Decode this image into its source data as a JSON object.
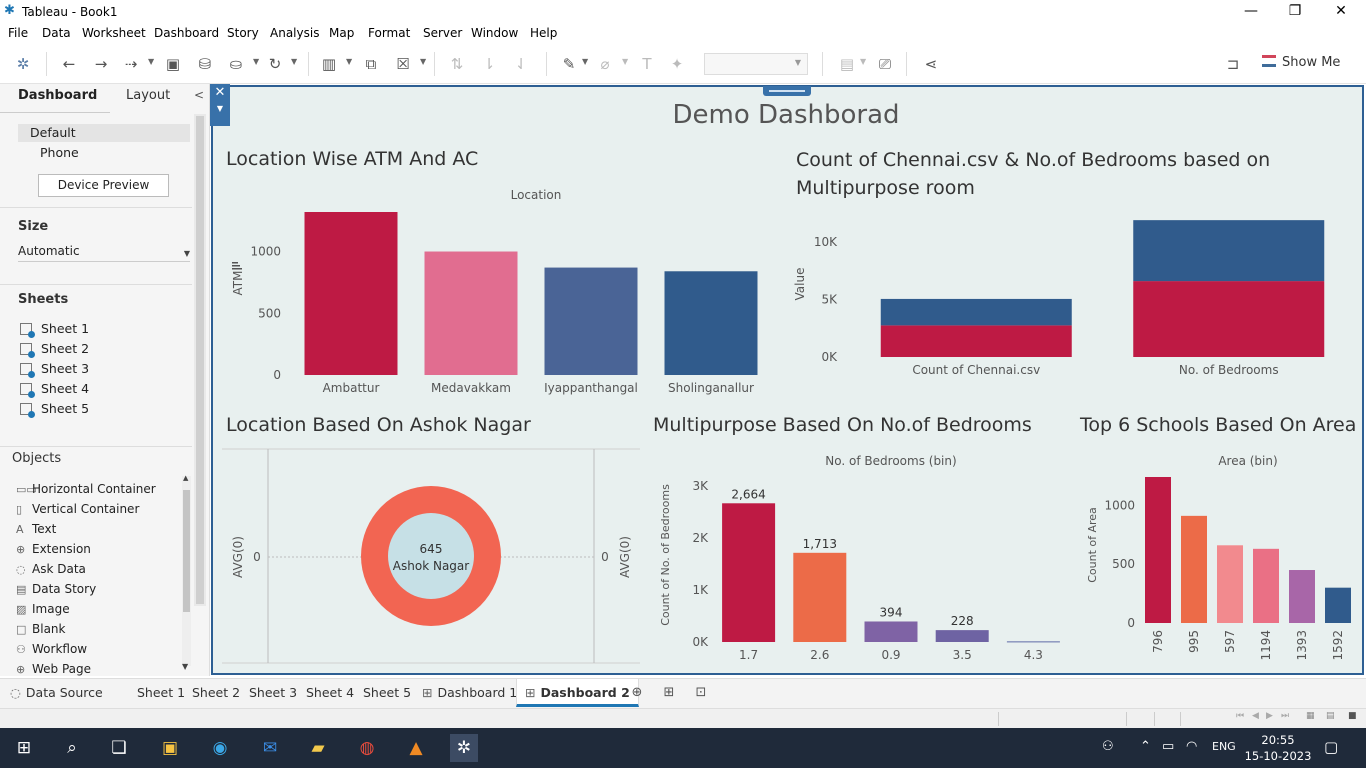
{
  "window": {
    "title": "Tableau - Book1"
  },
  "menu": [
    "File",
    "Data",
    "Worksheet",
    "Dashboard",
    "Story",
    "Analysis",
    "Map",
    "Format",
    "Server",
    "Window",
    "Help"
  ],
  "toolbar": {
    "show_me": "Show Me"
  },
  "left_panel": {
    "tabs": {
      "dashboard": "Dashboard",
      "layout": "Layout"
    },
    "devices": {
      "default": "Default",
      "phone": "Phone",
      "preview_button": "Device Preview"
    },
    "size": {
      "heading": "Size",
      "value": "Automatic"
    },
    "sheets_heading": "Sheets",
    "sheets": [
      "Sheet 1",
      "Sheet 2",
      "Sheet 3",
      "Sheet 4",
      "Sheet 5"
    ],
    "objects_heading": "Objects",
    "objects": [
      {
        "label": "Horizontal Container",
        "icon": "horizontal-container-icon"
      },
      {
        "label": "Vertical Container",
        "icon": "vertical-container-icon"
      },
      {
        "label": "Text",
        "icon": "text-icon"
      },
      {
        "label": "Extension",
        "icon": "extension-icon"
      },
      {
        "label": "Ask Data",
        "icon": "ask-data-icon"
      },
      {
        "label": "Data Story",
        "icon": "data-story-icon"
      },
      {
        "label": "Image",
        "icon": "image-icon"
      },
      {
        "label": "Blank",
        "icon": "blank-icon"
      },
      {
        "label": "Workflow",
        "icon": "workflow-icon"
      },
      {
        "label": "Web Page",
        "icon": "web-page-icon"
      }
    ]
  },
  "dashboard": {
    "title": "Demo Dashborad"
  },
  "chart_data": [
    {
      "id": "atm",
      "type": "bar",
      "title": "Location Wise ATM And AC",
      "xlabel": "Location",
      "ylabel": "ATM",
      "categories": [
        "Ambattur",
        "Medavakkam",
        "Iyappanthangal",
        "Sholinganallur"
      ],
      "values": [
        1320,
        1000,
        870,
        840
      ],
      "colors": [
        "#be1a44",
        "#e16d90",
        "#4a6496",
        "#305b8c"
      ],
      "yticks": [
        0,
        500,
        1000
      ],
      "ylim": [
        0,
        1320
      ]
    },
    {
      "id": "stacked",
      "type": "bar",
      "title": "Count of Chennai.csv & No.of Bedrooms based on Multipurpose room",
      "ylabel": "Value",
      "categories": [
        "Count of Chennai.csv",
        "No. of Bedrooms"
      ],
      "series": [
        {
          "values": [
            2750,
            6600
          ],
          "color": "#be1a44"
        },
        {
          "values": [
            2300,
            5300
          ],
          "color": "#305b8c"
        }
      ],
      "yticks": [
        0,
        5000,
        10000
      ],
      "yticklabels": [
        "0K",
        "5K",
        "10K"
      ],
      "ylim": [
        0,
        12000
      ]
    },
    {
      "id": "donut",
      "type": "pie",
      "title": "Location Based On Ashok Nagar",
      "center_value": "645",
      "center_label": "Ashok Nagar",
      "ylabel_left": "AVG(0)",
      "ylabel_right": "AVG(0)",
      "axis_value_left": "0",
      "axis_value_right": "0",
      "ring_color": "#f26552",
      "hole_color": "#c6e0e6"
    },
    {
      "id": "bedrooms",
      "type": "bar",
      "title": "Multipurpose Based On No.of Bedrooms",
      "xlabel": "No. of Bedrooms (bin)",
      "ylabel": "Count of No. of Bedrooms",
      "categories": [
        "1.7",
        "2.6",
        "0.9",
        "3.5",
        "4.3"
      ],
      "values": [
        2664,
        1713,
        394,
        228,
        12
      ],
      "data_labels": [
        "2,664",
        "1,713",
        "394",
        "228",
        ""
      ],
      "colors": [
        "#be1a44",
        "#ec6b48",
        "#7f63a5",
        "#6e63a3",
        "#5e6aa6"
      ],
      "yticks": [
        0,
        1000,
        2000,
        3000
      ],
      "yticklabels": [
        "0K",
        "1K",
        "2K",
        "3K"
      ],
      "ylim": [
        0,
        2900
      ]
    },
    {
      "id": "schools",
      "type": "bar",
      "title": "Top 6 Schools Based On Area",
      "xlabel": "Area (bin)",
      "ylabel": "Count of Area",
      "categories": [
        "796",
        "995",
        "597",
        "1194",
        "1393",
        "1592"
      ],
      "values": [
        1240,
        910,
        660,
        630,
        450,
        300
      ],
      "colors": [
        "#be1a44",
        "#ec6b48",
        "#f28a8e",
        "#ea7085",
        "#a866a8",
        "#305b8c"
      ],
      "yticks": [
        0,
        500,
        1000
      ],
      "ylim": [
        0,
        1240
      ]
    }
  ],
  "bottom_tabs": [
    "Data Source",
    "Sheet 1",
    "Sheet 2",
    "Sheet 3",
    "Sheet 4",
    "Sheet 5",
    "Dashboard 1",
    "Dashboard 2"
  ],
  "active_tab": "Dashboard 2",
  "taskbar": {
    "time": "20:55",
    "date": "15-10-2023",
    "lang": "ENG"
  }
}
